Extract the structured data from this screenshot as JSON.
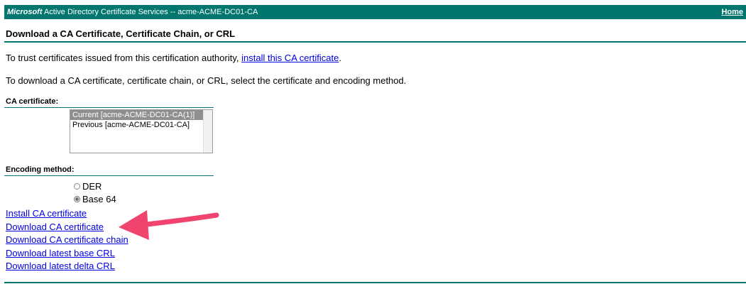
{
  "header": {
    "brand_bold": "Microsoft",
    "brand_rest": " Active Directory Certificate Services  --  acme-ACME-DC01-CA",
    "home_label": "Home"
  },
  "page": {
    "title": "Download a CA Certificate, Certificate Chain, or CRL",
    "trust_text": "To trust certificates issued from this certification authority, ",
    "trust_link": "install this CA certificate",
    "trust_suffix": ".",
    "instructions": "To download a CA certificate, certificate chain, or CRL, select the certificate and encoding method."
  },
  "ca_certificate": {
    "label": "CA certificate:",
    "options": [
      {
        "label": "Current [acme-ACME-DC01-CA(1)]",
        "selected": true
      },
      {
        "label": "Previous [acme-ACME-DC01-CA]",
        "selected": false
      }
    ]
  },
  "encoding": {
    "label": "Encoding method:",
    "options": [
      {
        "label": "DER",
        "checked": false
      },
      {
        "label": "Base 64",
        "checked": true
      }
    ]
  },
  "actions": [
    {
      "label": "Install CA certificate"
    },
    {
      "label": "Download CA certificate"
    },
    {
      "label": "Download CA certificate chain"
    },
    {
      "label": "Download latest base CRL"
    },
    {
      "label": "Download latest delta CRL"
    }
  ],
  "colors": {
    "header_bg": "#00766f",
    "link": "#0000e0",
    "annotation_arrow": "#f0446f"
  }
}
